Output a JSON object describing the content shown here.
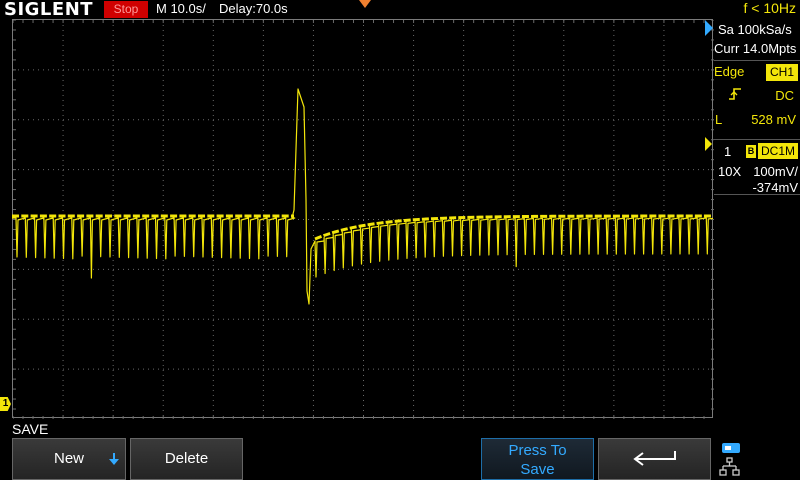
{
  "header": {
    "brand": "SIGLENT",
    "status": "Stop",
    "timebase": "M 10.0s/",
    "delay": "Delay:70.0s",
    "frequency": "f < 10Hz"
  },
  "acquisition": {
    "sample_rate": "Sa 100kSa/s",
    "memory_depth": "Curr 14.0Mpts"
  },
  "trigger": {
    "type": "Edge",
    "source": "CH1",
    "coupling": "DC",
    "level_label": "L",
    "level": "528 mV"
  },
  "channel1": {
    "number": "1",
    "bw_badge": "B",
    "coupling": "DC1M",
    "probe": "10X",
    "scale": "100mV/",
    "offset": "-374mV",
    "marker": "1"
  },
  "menu": {
    "title": "SAVE",
    "softkeys": {
      "new": "New",
      "delete": "Delete",
      "press_line1": "Press To",
      "press_line2": "Save"
    }
  },
  "colors": {
    "ch1": "#f3e60a",
    "accent": "#33aaff",
    "stop": "#d00000"
  }
}
